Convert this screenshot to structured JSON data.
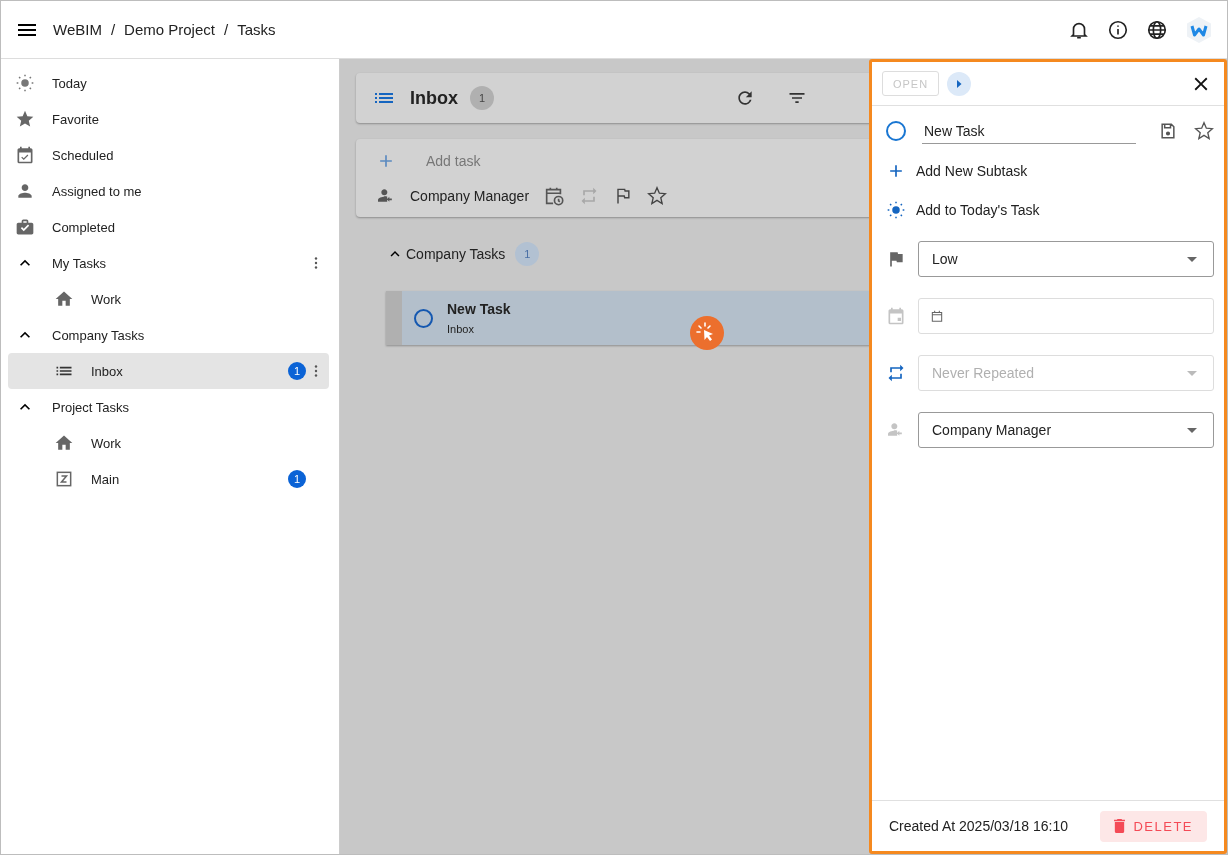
{
  "header": {
    "crumbs": [
      "WeBIM",
      "Demo Project",
      "Tasks"
    ],
    "separator": "/"
  },
  "sidebar": {
    "items": [
      {
        "kind": "today",
        "label": "Today",
        "selected": false
      },
      {
        "kind": "favorite",
        "label": "Favorite",
        "selected": false
      },
      {
        "kind": "scheduled",
        "label": "Scheduled",
        "selected": false
      },
      {
        "kind": "assigned",
        "label": "Assigned to me",
        "selected": false
      },
      {
        "kind": "completed",
        "label": "Completed",
        "selected": false
      },
      {
        "kind": "group",
        "label": "My Tasks",
        "expanded": true,
        "menu": true,
        "selected": false,
        "children": [
          {
            "kind": "home",
            "label": "Work",
            "selected": false,
            "menu": false
          }
        ]
      },
      {
        "kind": "group",
        "label": "Company Tasks",
        "expanded": true,
        "menu": false,
        "selected": false,
        "children": [
          {
            "kind": "list",
            "label": "Inbox",
            "badge": "1",
            "selected": true,
            "menu": true
          }
        ]
      },
      {
        "kind": "group",
        "label": "Project Tasks",
        "expanded": true,
        "menu": false,
        "selected": false,
        "children": [
          {
            "kind": "home",
            "label": "Work",
            "selected": false,
            "menu": false
          },
          {
            "kind": "board",
            "label": "Main",
            "badge": "1",
            "selected": false,
            "menu": false
          }
        ]
      }
    ]
  },
  "list_header": {
    "title": "Inbox",
    "count": "1"
  },
  "add_task": {
    "placeholder": "Add task",
    "assignee": "Company Manager"
  },
  "groups": [
    {
      "title": "Company Tasks",
      "count": "1",
      "expanded": true,
      "tasks": [
        {
          "title": "New Task",
          "list": "Inbox",
          "selected": true,
          "completed": false
        }
      ]
    }
  ],
  "detail_panel": {
    "status_button": {
      "label": "OPEN",
      "disabled": true
    },
    "task_name": "New Task",
    "completed": false,
    "actions": [
      {
        "kind": "subtask",
        "label": "Add New Subtask"
      },
      {
        "kind": "today",
        "label": "Add to Today's Task"
      }
    ],
    "fields": [
      {
        "kind": "priority",
        "value": "Low",
        "disabled": false
      },
      {
        "kind": "date"
      },
      {
        "kind": "repeat",
        "placeholder": "Never Repeated",
        "disabled": true
      },
      {
        "kind": "assignee",
        "value": "Company Manager",
        "disabled": false
      }
    ],
    "created": "Created At 2025/03/18 16:10",
    "delete_button": "DELETE"
  }
}
